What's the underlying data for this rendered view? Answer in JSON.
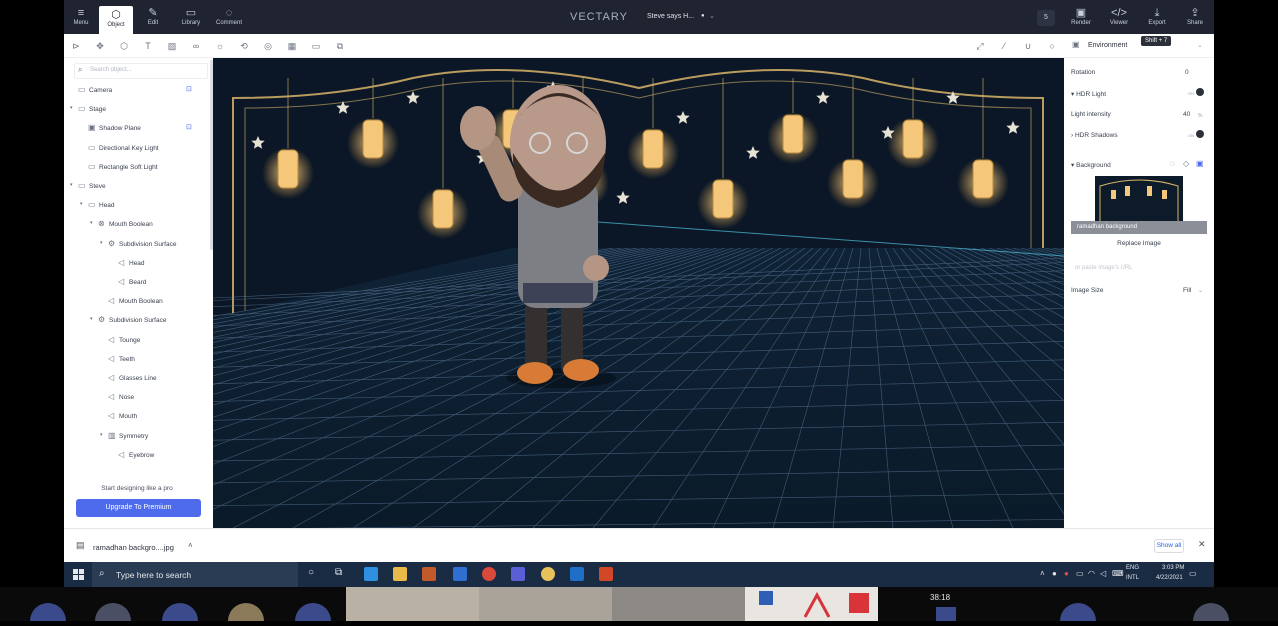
{
  "app": {
    "brand": "VECTARY",
    "document_title": "Steve says H...",
    "document_dot": "●",
    "user_count": "5"
  },
  "toolbar_left": [
    {
      "label": "Menu",
      "icon": "hamburger-icon"
    },
    {
      "label": "Object",
      "icon": "cube-icon",
      "active": true
    },
    {
      "label": "Edit",
      "icon": "pen-icon"
    },
    {
      "label": "Library",
      "icon": "folder-icon"
    },
    {
      "label": "Comment",
      "icon": "comment-icon"
    }
  ],
  "toolbar_right": [
    {
      "label": "Render",
      "icon": "render-icon"
    },
    {
      "label": "Viewer",
      "icon": "code-icon"
    },
    {
      "label": "Export",
      "icon": "download-icon"
    },
    {
      "label": "Share",
      "icon": "share-icon"
    }
  ],
  "tooltip": "Shift + 7",
  "environment_label": "Environment",
  "search": {
    "placeholder": "Search object..."
  },
  "tree": [
    {
      "label": "Camera",
      "depth": 0,
      "icon": "folder",
      "lock": true
    },
    {
      "label": "Stage",
      "depth": 0,
      "icon": "folder",
      "arrow": true
    },
    {
      "label": "Shadow Plane",
      "depth": 1,
      "icon": "plane",
      "lock": true
    },
    {
      "label": "Directional Key Light",
      "depth": 1,
      "icon": "light"
    },
    {
      "label": "Rectangle Soft Light",
      "depth": 1,
      "icon": "light"
    },
    {
      "label": "Steve",
      "depth": 0,
      "icon": "folder",
      "arrow": true
    },
    {
      "label": "Head",
      "depth": 1,
      "icon": "folder",
      "arrow": true
    },
    {
      "label": "Mouth Boolean",
      "depth": 2,
      "icon": "boolean",
      "arrow": true
    },
    {
      "label": "Subdivision Surface",
      "depth": 3,
      "icon": "gear",
      "arrow": true
    },
    {
      "label": "Head",
      "depth": 4,
      "icon": "mesh"
    },
    {
      "label": "Beard",
      "depth": 4,
      "icon": "mesh"
    },
    {
      "label": "Mouth Boolean",
      "depth": 3,
      "icon": "mesh"
    },
    {
      "label": "Subdivision Surface",
      "depth": 2,
      "icon": "gear",
      "arrow": true
    },
    {
      "label": "Tounge",
      "depth": 3,
      "icon": "mesh"
    },
    {
      "label": "Teeth",
      "depth": 3,
      "icon": "mesh"
    },
    {
      "label": "Glasses Line",
      "depth": 3,
      "icon": "mesh"
    },
    {
      "label": "Nose",
      "depth": 3,
      "icon": "mesh"
    },
    {
      "label": "Mouth",
      "depth": 3,
      "icon": "mesh"
    },
    {
      "label": "Symmetry",
      "depth": 3,
      "icon": "symmetry",
      "arrow": true
    },
    {
      "label": "Eyebrow",
      "depth": 4,
      "icon": "mesh"
    }
  ],
  "promo": {
    "text": "Start designing like a pro",
    "button": "Upgrade To Premium"
  },
  "properties": {
    "rotation_label": "Rotation",
    "rotation_value": "0",
    "hdr_light_label": "HDR Light",
    "hdr_light_toggle": "ON",
    "light_intensity_label": "Light intensity",
    "light_intensity_value": "40",
    "light_intensity_unit": "%",
    "hdr_shadows_label": "HDR Shadows",
    "hdr_shadows_toggle": "ON",
    "background_label": "Background",
    "background_image_name": "ramadhan background",
    "replace_image": "Replace Image",
    "url_placeholder": "or paste image's URL",
    "image_size_label": "Image Size",
    "image_size_value": "Fill"
  },
  "downloads": {
    "file_name": "ramadhan backgro....jpg",
    "show_all": "Show all"
  },
  "taskbar": {
    "search_placeholder": "Type here to search",
    "lang_line1": "ENG",
    "lang_line2": "INTL",
    "time": "3:03 PM",
    "date": "4/22/2021"
  },
  "meeting": {
    "timer": "38:18"
  },
  "colors": {
    "accent": "#4f6bed",
    "topbar": "#1f2430",
    "viewport": "#0a1624",
    "grid": "#6f8fb5",
    "gold": "#d9b46a",
    "taskbar": "#1a2b44"
  }
}
